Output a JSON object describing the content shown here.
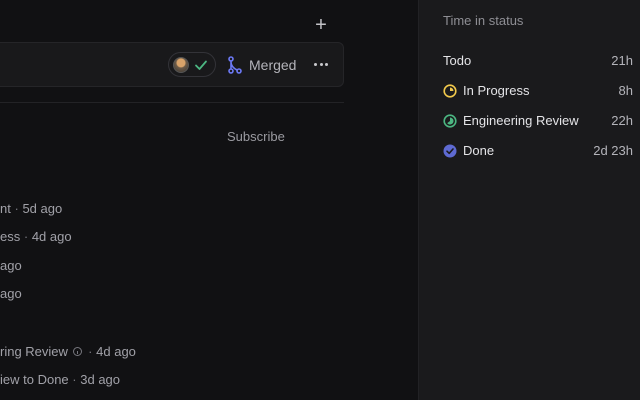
{
  "header": {
    "add_icon": "plus-icon"
  },
  "pr": {
    "review_status_icon": "check-icon",
    "review_color": "#4cb782",
    "merge_icon": "git-merge-icon",
    "merge_color": "#6c79f5",
    "status_label": "Merged",
    "more_icon": "ellipsis-icon"
  },
  "subscribe_label": "Subscribe",
  "activity": [
    {
      "text": "nt",
      "time": "5d ago"
    },
    {
      "text": "ess",
      "time": "4d ago"
    },
    {
      "text": "",
      "time": "ago"
    },
    {
      "text": "",
      "time": "ago"
    },
    {
      "text": "ring Review",
      "time": "4d ago"
    },
    {
      "text": "iew to Done",
      "time": "3d ago"
    }
  ],
  "sep": "·",
  "sidebar": {
    "title": "Time in status",
    "statuses": [
      {
        "name": "Todo",
        "time": "21h",
        "icon": "none"
      },
      {
        "name": "In Progress",
        "time": "8h",
        "icon": "in-progress-icon",
        "color": "#f2c94c"
      },
      {
        "name": "Engineering Review",
        "time": "22h",
        "icon": "review-icon",
        "color": "#4cb782"
      },
      {
        "name": "Done",
        "time": "2d 23h",
        "icon": "done-icon",
        "color": "#5e6ad2"
      }
    ]
  }
}
